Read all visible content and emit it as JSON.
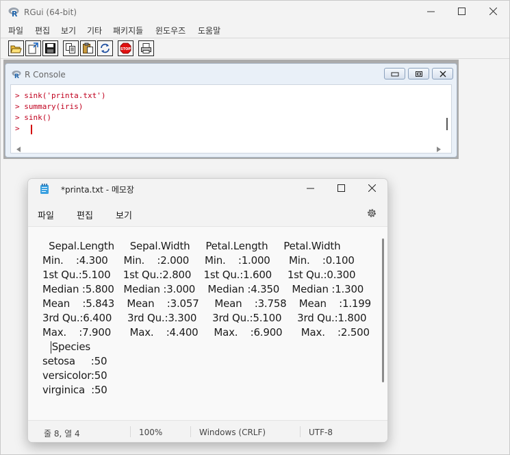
{
  "rgui": {
    "title": "RGui (64-bit)",
    "menu": [
      "파일",
      "편집",
      "보기",
      "기타",
      "패키지들",
      "윈도우즈",
      "도움말"
    ],
    "toolbar_icons": [
      "open-script-icon",
      "load-workspace-icon",
      "save-workspace-icon",
      "copy-icon",
      "paste-icon",
      "copy-paste-icon",
      "stop-icon",
      "print-icon"
    ],
    "stop_label": "STOP"
  },
  "console": {
    "title": "R Console",
    "lines": [
      "> sink('printa.txt')",
      "> summary(iris)",
      "> sink()",
      "> "
    ],
    "text_color": "#c0001e"
  },
  "notepad": {
    "title": "*printa.txt - 메모장",
    "menu": [
      "파일",
      "편집",
      "보기"
    ],
    "lines": [
      "  Sepal.Length     Sepal.Width     Petal.Length     Petal.Width",
      "Min.    :4.300     Min.    :2.000     Min.    :1.000      Min.    :0.100",
      "1st Qu.:5.100    1st Qu.:2.800    1st Qu.:1.600     1st Qu.:0.300",
      "Median :5.800   Median :3.000    Median :4.350    Median :1.300",
      "Mean    :5.843    Mean    :3.057     Mean    :3.758    Mean    :1.199",
      "3rd Qu.:6.400     3rd Qu.:3.300     3rd Qu.:5.100     3rd Qu.:1.800",
      "Max.    :7.900      Max.    :4.400     Max.    :6.900      Max.    :2.500",
      "   Species",
      "setosa     :50",
      "versicolor:50",
      "virginica  :50"
    ],
    "status": {
      "position": "줄 8, 열 4",
      "zoom": "100%",
      "line_ending": "Windows (CRLF)",
      "encoding": "UTF-8"
    }
  }
}
